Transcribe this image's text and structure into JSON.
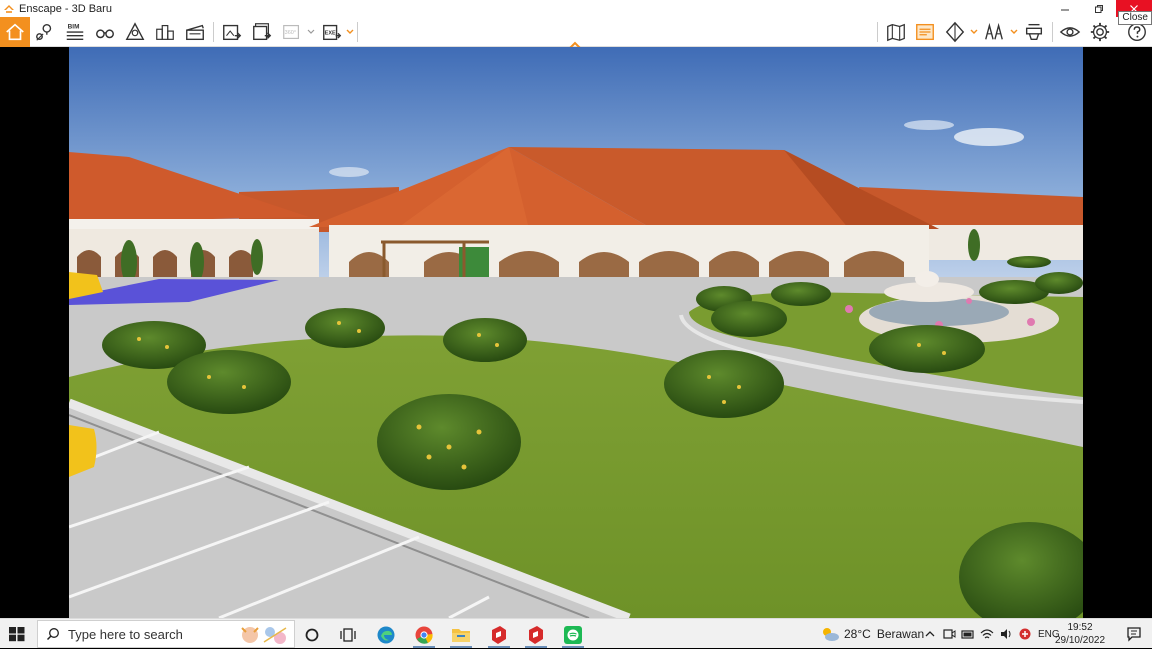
{
  "window": {
    "title": "Enscape - 3D Baru",
    "tooltip": "Close"
  },
  "toolbar": {
    "bim_label": "BIM",
    "panorama_label": "360°",
    "exe_label": "EXE",
    "left_icons": [
      "home-icon",
      "views-pin-icon",
      "bim-icon",
      "binoculars-icon",
      "asset-library-icon",
      "site-context-icon",
      "video-editor-icon",
      "screenshot-icon",
      "batch-render-icon",
      "panorama-icon",
      "exe-export-icon"
    ],
    "right_icons": [
      "map-icon",
      "material-editor-icon",
      "view-mode-icon",
      "atmosphere-icon",
      "collaboration-icon",
      "visibility-icon",
      "settings-icon",
      "help-icon"
    ]
  },
  "colors": {
    "accent": "#f3901f",
    "close_red": "#e81123"
  },
  "taskbar": {
    "search_placeholder": "Type here to search",
    "weather_temp": "28°C",
    "weather_text": "Berawan",
    "language": "ENG",
    "time": "19:52",
    "date": "29/10/2022",
    "apps": [
      "cortana-icon",
      "task-view-icon",
      "edge-icon",
      "chrome-icon",
      "file-explorer-icon",
      "sketchup-icon",
      "sketchup-icon",
      "spotify-icon"
    ]
  }
}
